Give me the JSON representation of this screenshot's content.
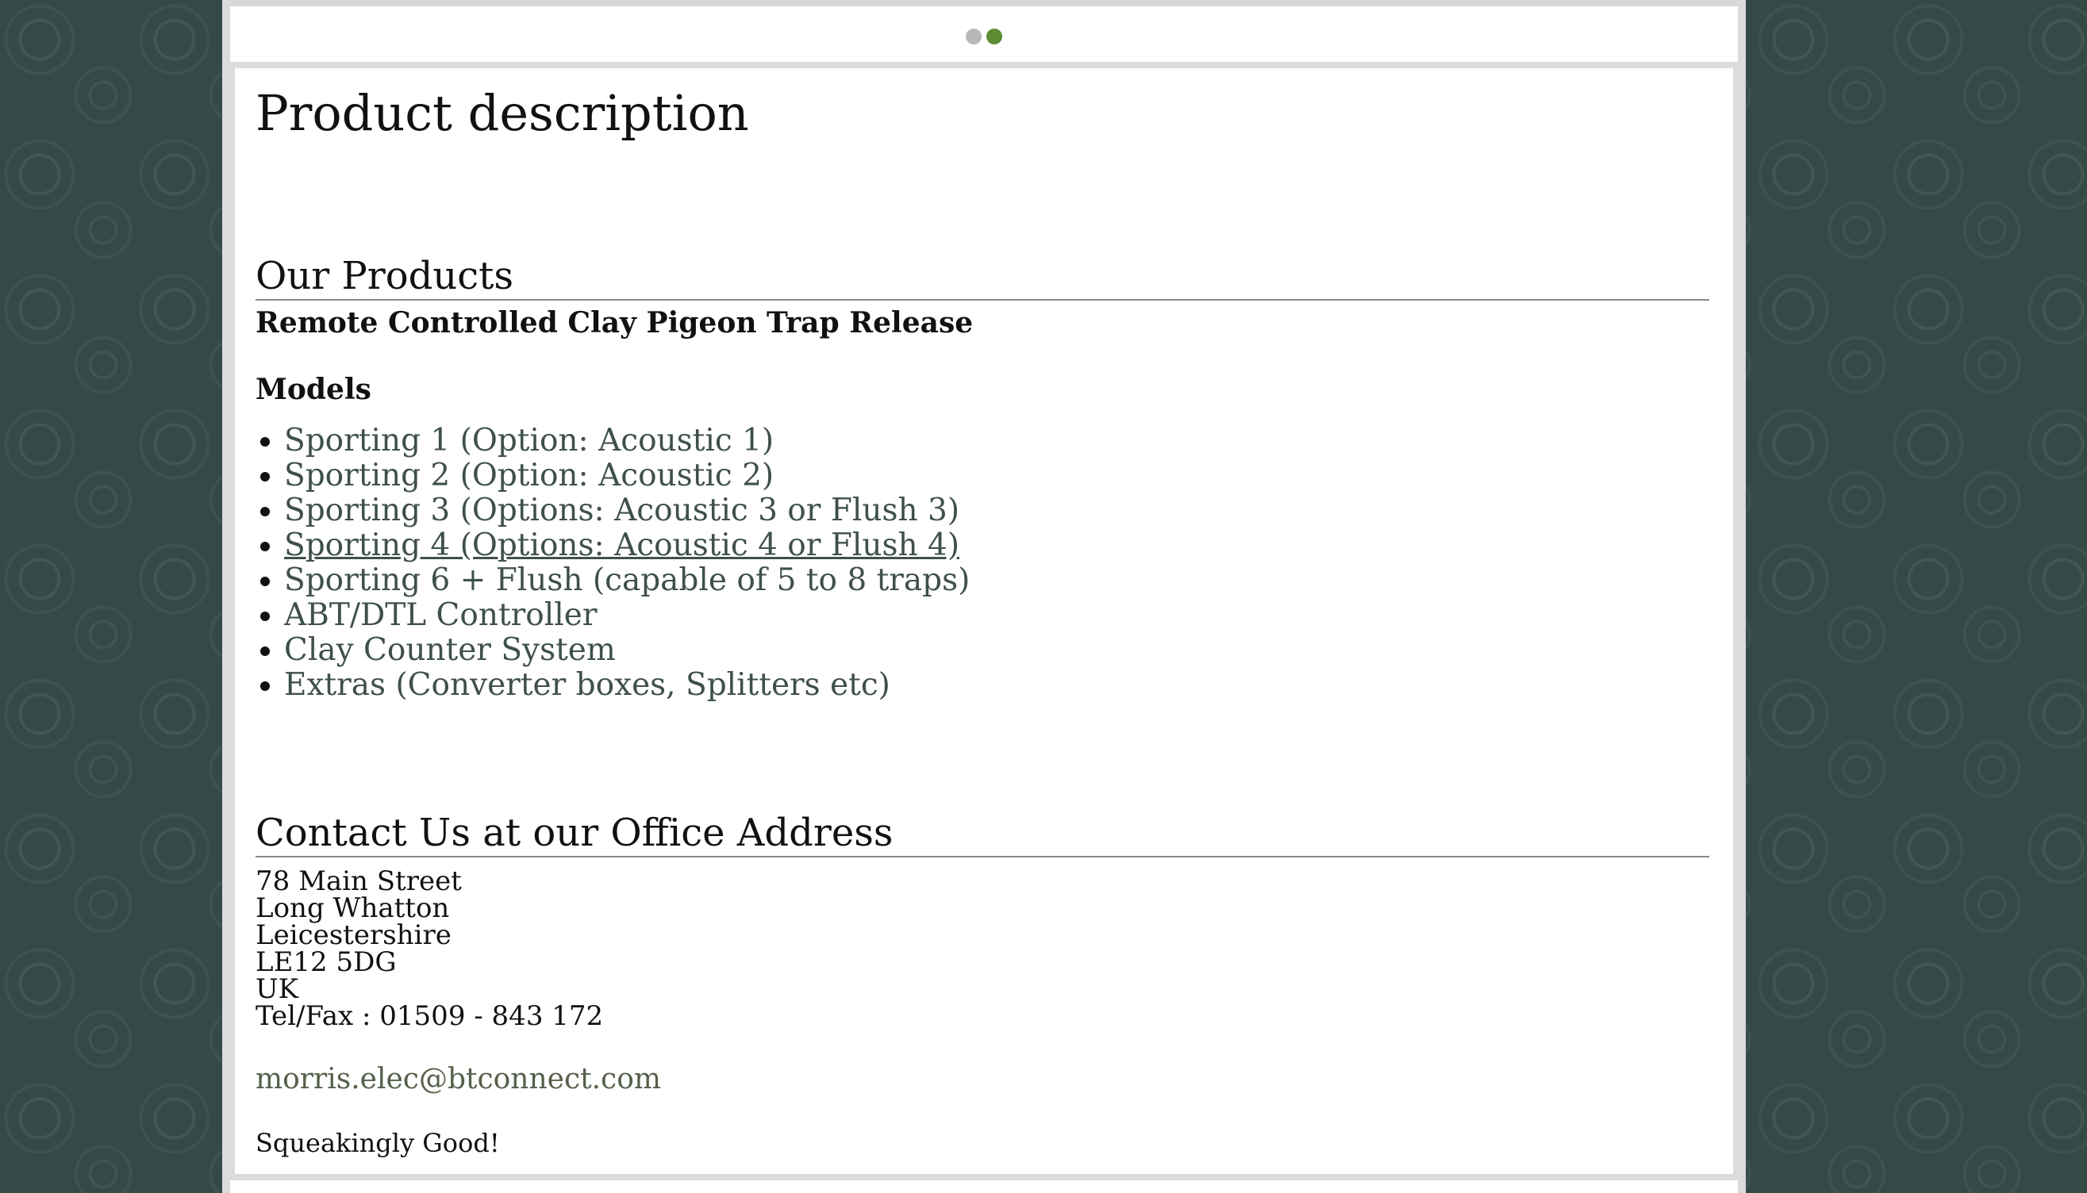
{
  "slider": {
    "dots": [
      {
        "state": "inactive"
      },
      {
        "state": "active"
      }
    ],
    "active_color": "#5c8c34",
    "inactive_color": "#b8b8b8"
  },
  "main": {
    "page_title": "Product description",
    "products_heading": "Our Products",
    "product_name": "Remote Controlled Clay Pigeon Trap Release",
    "models_label": "Models",
    "models": [
      "Sporting 1 (Option: Acoustic 1)",
      "Sporting 2 (Option: Acoustic 2)",
      "Sporting 3 (Options: Acoustic 3 or Flush 3)",
      "Sporting 4 (Options: Acoustic 4 or Flush 4)",
      "Sporting 6 + Flush (capable of 5 to 8 traps)",
      "ABT/DTL Controller",
      "Clay Counter System",
      "Extras (Converter boxes, Splitters etc)"
    ],
    "contact_heading": "Contact Us at our Office Address",
    "address": {
      "street": "78 Main Street",
      "town": "Long Whatton",
      "county": "Leicestershire",
      "postcode": "LE12 5DG",
      "country": "UK",
      "phone": "Tel/Fax : 01509 - 843 172"
    },
    "email": "morris.elec@btconnect.com",
    "tagline": "Squeakingly Good!"
  },
  "colors": {
    "background": "#344a47",
    "link": "#3f504c",
    "email_link": "#55604a"
  }
}
